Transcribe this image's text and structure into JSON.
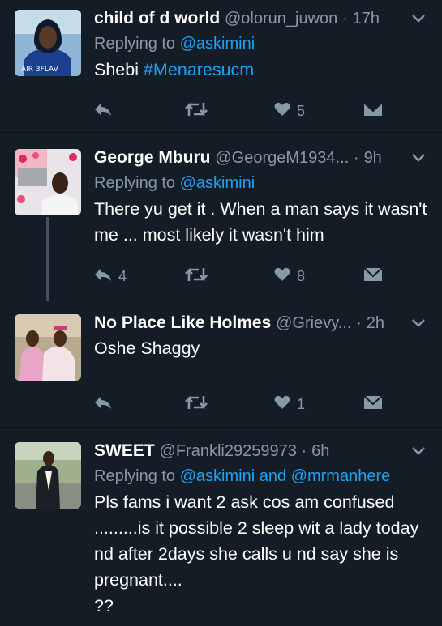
{
  "tweets": [
    {
      "name": "child of d world",
      "handle": "@olorun_juwon",
      "sep": "·",
      "time": "17h",
      "replying_prefix": "Replying to",
      "replying_to": "@askimini",
      "body_text": "Shebi ",
      "body_hashtag": "#Menaresucm",
      "reply_count": "",
      "retweet_count": "",
      "like_count": "5"
    },
    {
      "name": "George Mburu",
      "handle": "@GeorgeM1934...",
      "sep": "·",
      "time": "9h",
      "replying_prefix": "Replying to",
      "replying_to": "@askimini",
      "body_text": "There yu get it . When a man says it wasn't me ... most likely it wasn't him",
      "reply_count": "4",
      "retweet_count": "",
      "like_count": "8"
    },
    {
      "name": "No Place Like Holmes",
      "handle": "@Grievy...",
      "sep": "·",
      "time": "2h",
      "body_text": "Oshe Shaggy",
      "reply_count": "",
      "retweet_count": "",
      "like_count": "1"
    },
    {
      "name": "SWEET",
      "handle": "@Frankli29259973",
      "sep": "·",
      "time": "6h",
      "replying_prefix": "Replying to",
      "replying_to_1": "@askimini",
      "replying_and": "and",
      "replying_to_2": "@mrmanhere",
      "body_text": "Pls fams i want 2 ask cos am confused .........is it possible 2 sleep wit a lady today nd after 2days she calls u nd say she is pregnant....",
      "body_text_2": "??"
    }
  ],
  "icons": {
    "reply": "reply-icon",
    "retweet": "retweet-icon",
    "like": "heart-icon",
    "dm": "direct-message-icon",
    "more": "chevron-down-icon"
  },
  "colors": {
    "background": "#141d26",
    "accent": "#1da1f2",
    "muted": "#8899a6",
    "text": "#ffffff",
    "thread_line": "#3d5466"
  }
}
